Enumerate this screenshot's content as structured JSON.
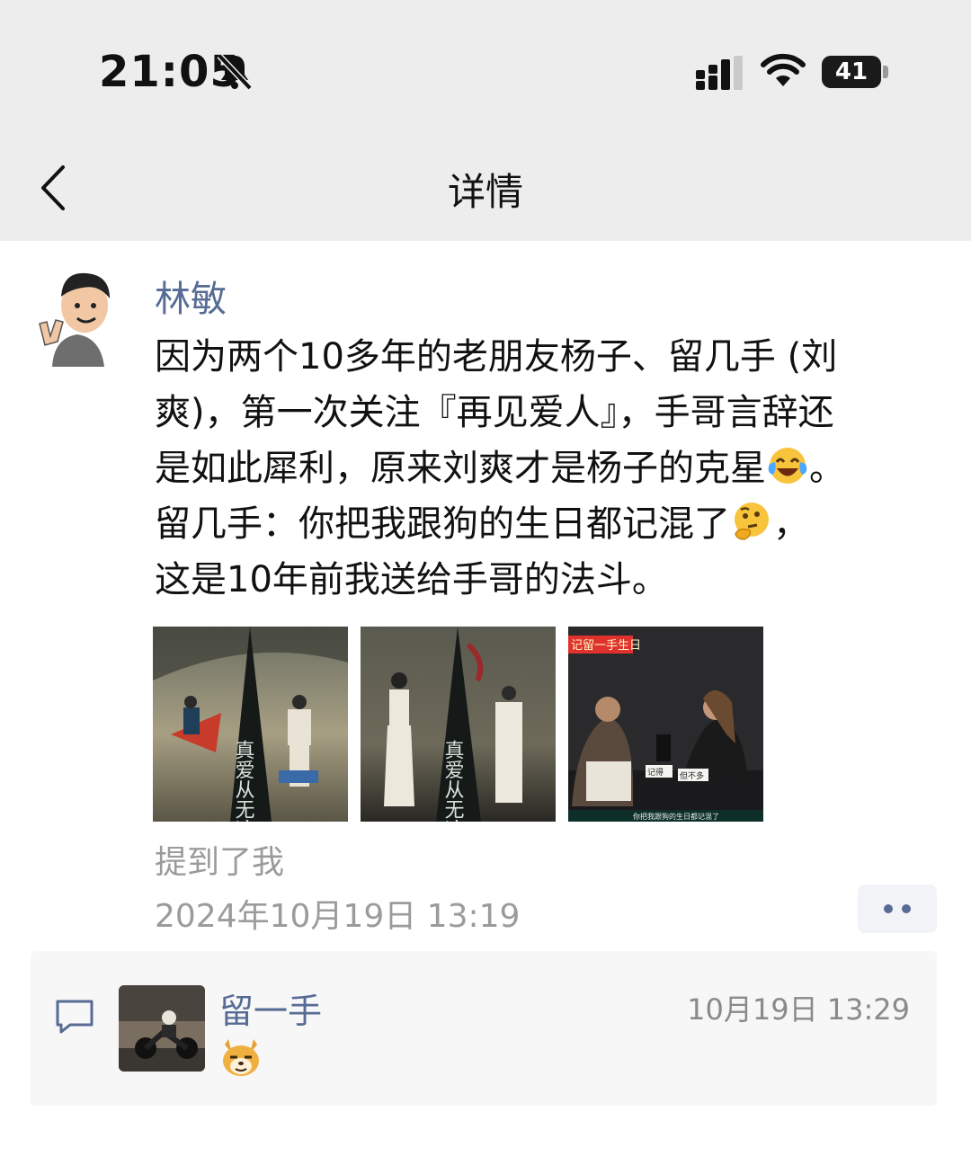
{
  "status_bar": {
    "time": "21:05",
    "battery": "41"
  },
  "nav": {
    "title": "详情"
  },
  "post": {
    "author": "林敏",
    "lines": [
      "因为两个10多年的老朋友杨子、留几手 (刘",
      "爽)，第一次关注『再见爱人』，手哥言辞还",
      "是如此犀利，原来刘爽才是杨子的克星",
      "留几手：你把我跟狗的生日都记混了",
      "这是10年前我送给手哥的法斗。"
    ],
    "line3_tail": "。",
    "line4_tail": "，",
    "mention": "提到了我",
    "timestamp": "2024年10月19日 13:19",
    "photos": [
      {
        "caption_text": "真爱从无迹"
      },
      {
        "caption_text": "真爱从无迹"
      },
      {
        "overlay_title": "记留一手生日",
        "subtitle_left": "记得",
        "subtitle_right": "但不多",
        "bottom_caption": "你把我跟狗的生日都记混了"
      }
    ]
  },
  "comment": {
    "name": "留一手",
    "time": "10月19日 13:29"
  },
  "icons": {
    "bell": "bell-slash-icon",
    "signal": "cellular-signal-icon",
    "wifi": "wifi-icon",
    "back": "chevron-left-icon",
    "more": "more-dots-icon",
    "comment": "comment-bubble-icon",
    "emoji_laugh": "laughing-crying-emoji",
    "emoji_think": "thinking-emoji",
    "emoji_doge": "doge-emoji"
  },
  "colors": {
    "link": "#576b95",
    "header_bg": "#ededed",
    "meta_text": "#9b9b9b"
  }
}
